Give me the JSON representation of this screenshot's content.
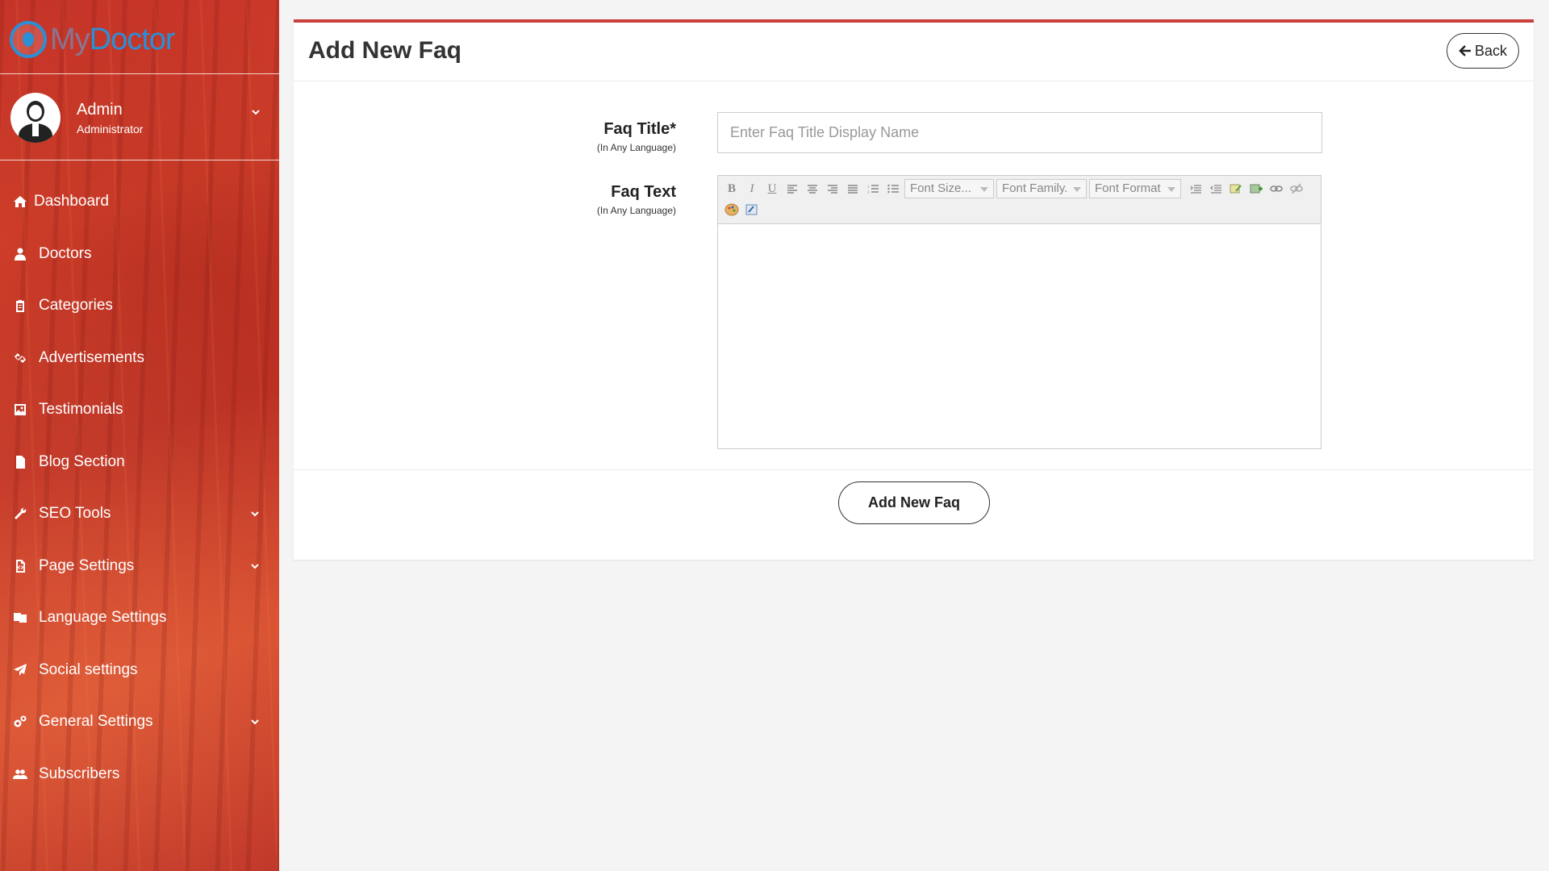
{
  "brand": {
    "name_part1": "My",
    "name_part2": "Doctor"
  },
  "user": {
    "name": "Admin",
    "role": "Administrator"
  },
  "nav": [
    {
      "label": "Dashboard",
      "icon": "home-icon",
      "expandable": false
    },
    {
      "label": "Doctors",
      "icon": "user-md-icon",
      "expandable": false
    },
    {
      "label": "Categories",
      "icon": "clipboard-icon",
      "expandable": false
    },
    {
      "label": "Advertisements",
      "icon": "link-icon",
      "expandable": false
    },
    {
      "label": "Testimonials",
      "icon": "image-icon",
      "expandable": false
    },
    {
      "label": "Blog Section",
      "icon": "document-icon",
      "expandable": false
    },
    {
      "label": "SEO Tools",
      "icon": "wrench-icon",
      "expandable": true
    },
    {
      "label": "Page Settings",
      "icon": "file-code-icon",
      "expandable": true
    },
    {
      "label": "Language Settings",
      "icon": "language-icon",
      "expandable": false
    },
    {
      "label": "Social settings",
      "icon": "paper-plane-icon",
      "expandable": false
    },
    {
      "label": "General Settings",
      "icon": "cogs-icon",
      "expandable": true
    },
    {
      "label": "Subscribers",
      "icon": "users-icon",
      "expandable": false
    }
  ],
  "page": {
    "title": "Add New Faq",
    "back_label": "Back"
  },
  "form": {
    "faq_title": {
      "label": "Faq Title*",
      "sublabel": "(In Any Language)",
      "placeholder": "Enter Faq Title Display Name",
      "value": ""
    },
    "faq_text": {
      "label": "Faq Text",
      "sublabel": "(In Any Language)"
    },
    "editor": {
      "font_size": "Font Size...",
      "font_family": "Font Family.",
      "font_format": "Font Format"
    },
    "submit_label": "Add New Faq"
  },
  "colors": {
    "sidebar": "#c8352a",
    "accent": "#c9403c",
    "brand_blue": "#2b8fd6"
  }
}
